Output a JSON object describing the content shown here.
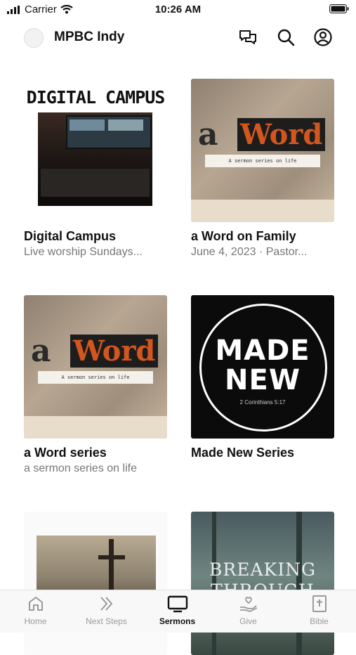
{
  "status_bar": {
    "carrier": "Carrier",
    "time": "10:26 AM"
  },
  "header": {
    "title": "MPBC Indy",
    "icons": [
      "chat-icon",
      "search-icon",
      "profile-icon"
    ]
  },
  "cards": [
    {
      "title": "Digital Campus",
      "subtitle": "Live worship Sundays...",
      "art_text": "DIGITAL CAMPUS"
    },
    {
      "title": "a Word on Family",
      "subtitle": "June 4, 2023 · Pastor...",
      "art_text_1": "a",
      "art_text_2": "Word",
      "art_caption": "A sermon series on life"
    },
    {
      "title": "a Word series",
      "subtitle": "a sermon series on life",
      "art_text_1": "a",
      "art_text_2": "Word",
      "art_caption": "A sermon series on life"
    },
    {
      "title": "Made New Series",
      "subtitle": "",
      "art_line_1": "MADE",
      "art_line_2": "NEW",
      "art_caption": "2 Corinthians 5:17"
    },
    {
      "title": "",
      "subtitle": ""
    },
    {
      "title": "",
      "subtitle": "",
      "art_line_1": "BREAKING",
      "art_line_2": "THROUGH"
    }
  ],
  "tabs": [
    {
      "label": "Home",
      "icon": "home-icon",
      "active": false
    },
    {
      "label": "Next Steps",
      "icon": "chevrons-icon",
      "active": false
    },
    {
      "label": "Sermons",
      "icon": "tv-icon",
      "active": true
    },
    {
      "label": "Give",
      "icon": "give-icon",
      "active": false
    },
    {
      "label": "Bible",
      "icon": "bible-icon",
      "active": false
    }
  ],
  "colors": {
    "accent": "#111111",
    "inactive_tab": "#9a9a9a",
    "subtitle": "#777777",
    "word_orange": "#d4561f"
  }
}
